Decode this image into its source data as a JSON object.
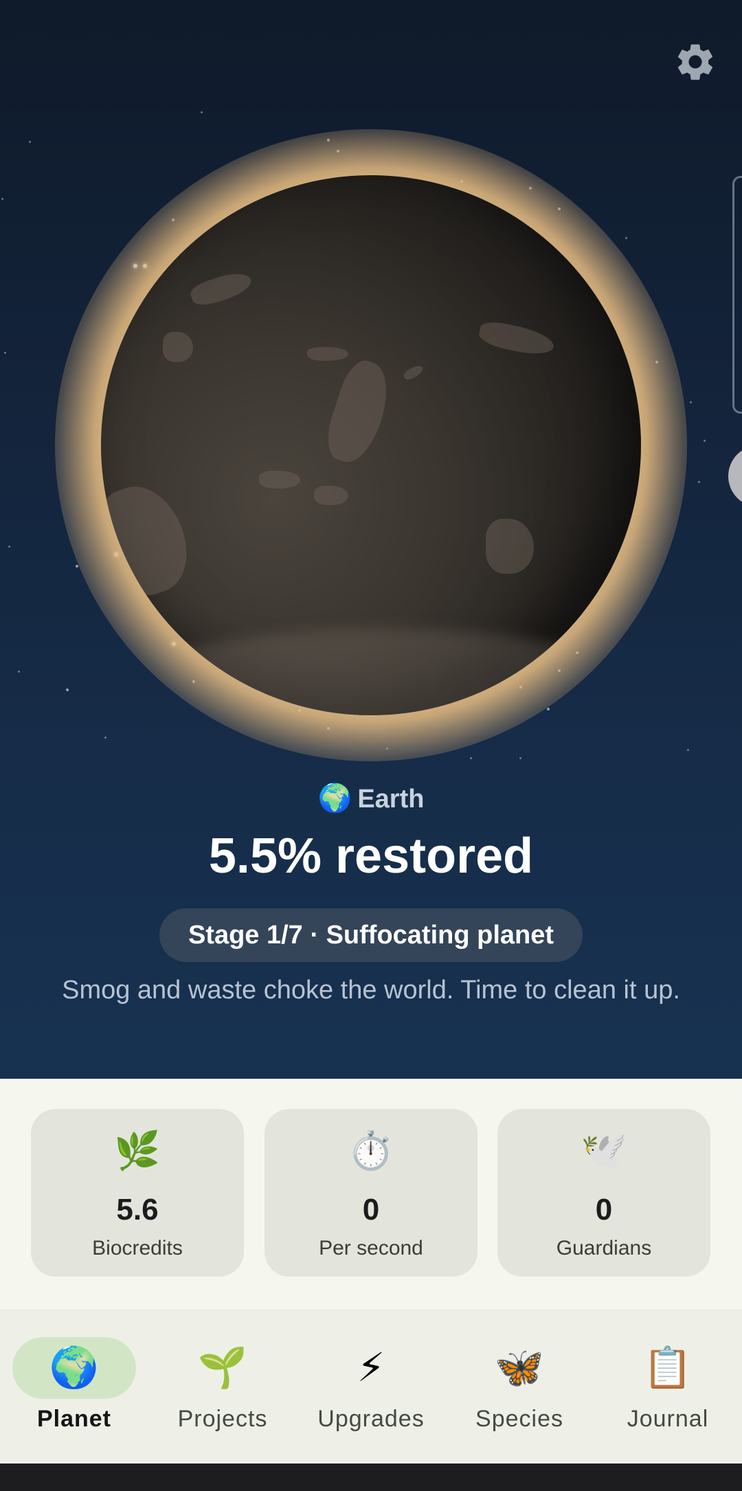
{
  "header": {
    "settings_icon": "gear-icon"
  },
  "planet": {
    "name": "Earth",
    "name_icon": "🌍",
    "restored_text": "5.5% restored",
    "restored_percent": 5.5,
    "stage_badge": "Stage 1/7 · Suffocating planet",
    "description": "Smog and waste choke the world. Time to clean it up."
  },
  "stats": [
    {
      "icon": "🌿",
      "value": "5.6",
      "label": "Biocredits"
    },
    {
      "icon": "⏱️",
      "value": "0",
      "label": "Per second"
    },
    {
      "icon": "🕊️",
      "value": "0",
      "label": "Guardians"
    }
  ],
  "nav": {
    "items": [
      {
        "icon": "🌍",
        "label": "Planet",
        "active": true
      },
      {
        "icon": "🌱",
        "label": "Projects",
        "active": false
      },
      {
        "icon": "⚡",
        "label": "Upgrades",
        "active": false
      },
      {
        "icon": "🦋",
        "label": "Species",
        "active": false
      },
      {
        "icon": "📋",
        "label": "Journal",
        "active": false
      }
    ]
  },
  "colors": {
    "sky_top": "#0f1a2a",
    "sky_bottom": "#173251",
    "planet_glow": "#eec88c",
    "stage_pill": "#344459",
    "stats_bg": "#f5f7ef",
    "card_bg": "#e3e5dd",
    "nav_active_pill": "#d2e6c6"
  }
}
